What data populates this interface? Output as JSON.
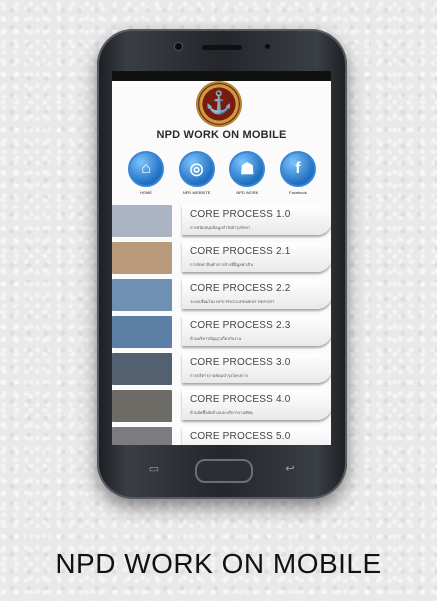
{
  "app": {
    "title": "NPD WORK ON MOBILE",
    "logo_icon": "anchor-emblem-icon"
  },
  "nav": [
    {
      "label": "HOME",
      "icon": "house-icon",
      "glyph": "⌂"
    },
    {
      "label": "NPD WEBSITE",
      "icon": "globe-icon",
      "glyph": "◎"
    },
    {
      "label": "NPD WORK",
      "icon": "hardhat-icon",
      "glyph": "☗"
    },
    {
      "label": "Facebook",
      "icon": "facebook-icon",
      "glyph": "f"
    }
  ],
  "processes": [
    {
      "title": "CORE PROCESS 1.0",
      "subtitle": "การสนับสนุนข้อมูลกำลังบำรุงรักษา",
      "thumb": "#a9b3c2"
    },
    {
      "title": "CORE PROCESS 2.1",
      "subtitle": "การจัดหาสินค้า/การจ้างที่มีมูลค่าเกิน",
      "thumb": "#b89a7a"
    },
    {
      "title": "CORE PROCESS 2.2",
      "subtitle": "ระบบเชื่อมโยง NPD PROCUREMENT REPORT",
      "thumb": "#6f8fb3"
    },
    {
      "title": "CORE PROCESS 2.3",
      "subtitle": "ด้านบริหารสัญญาเกี่ยวกับงาน",
      "thumb": "#5c7fa6"
    },
    {
      "title": "CORE PROCESS 3.0",
      "subtitle": "การบริหารงานซ่อมบำรุงโครงการ",
      "thumb": "#53606f"
    },
    {
      "title": "CORE PROCESS 4.0",
      "subtitle": "ด้านจัดซื้อจัดจ้างและบริหารงานพัสดุ",
      "thumb": "#6d6b66"
    },
    {
      "title": "CORE PROCESS 5.0",
      "subtitle": "",
      "thumb": "#7c7c80"
    }
  ],
  "caption": "NPD WORK ON MOBILE"
}
